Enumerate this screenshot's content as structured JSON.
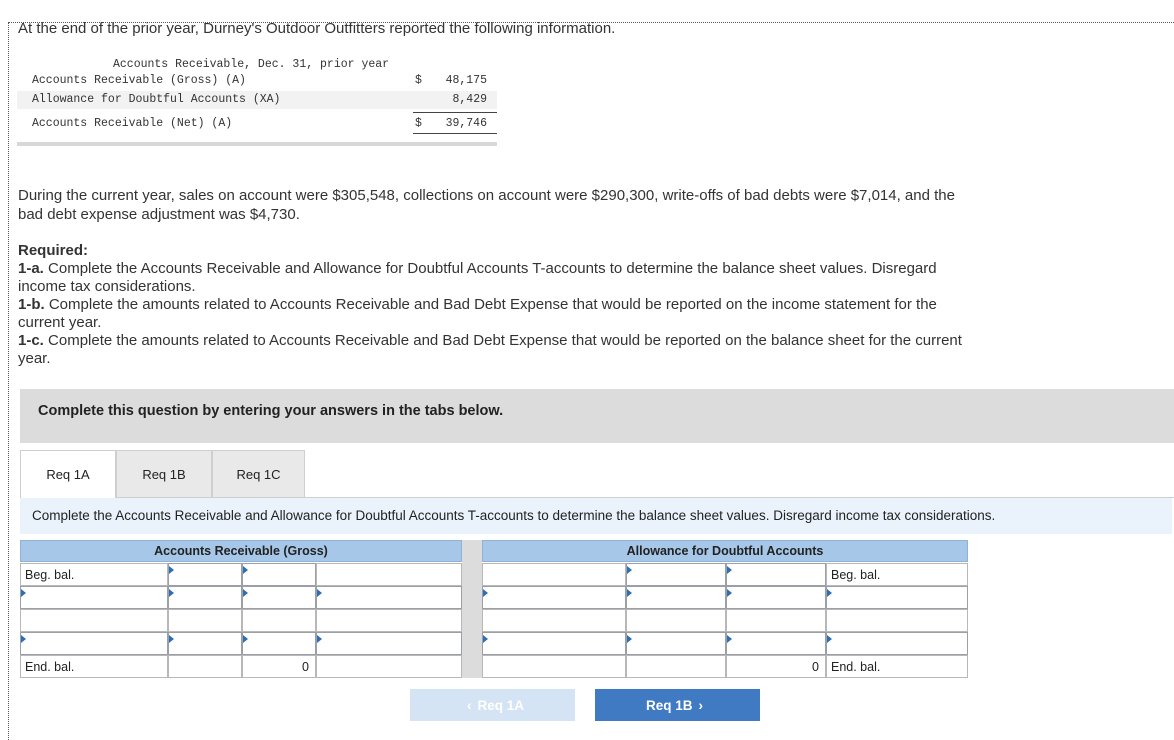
{
  "intro": "At the end of the prior year, Durney's Outdoor Outfitters reported the following information.",
  "mini_table": {
    "header": "Accounts Receivable, Dec. 31, prior year",
    "rows": [
      {
        "label": "Accounts Receivable (Gross) (A)",
        "currency": "$",
        "amount": "48,175"
      },
      {
        "label": "Allowance for Doubtful Accounts (XA)",
        "currency": "",
        "amount": "8,429"
      },
      {
        "label": "Accounts Receivable (Net) (A)",
        "currency": "$",
        "amount": "39,746"
      }
    ]
  },
  "paragraph": "During the current year, sales on account were $305,548, collections on account were $290,300, write-offs of bad debts were $7,014, and the bad debt expense adjustment was $4,730.",
  "required": {
    "heading": "Required:",
    "items": [
      {
        "tag": "1-a.",
        "text": "Complete the Accounts Receivable and Allowance for Doubtful Accounts T-accounts to determine the balance sheet values. Disregard income tax considerations."
      },
      {
        "tag": "1-b.",
        "text": "Complete the amounts related to Accounts Receivable and Bad Debt Expense that would be reported on the income statement for the current year."
      },
      {
        "tag": "1-c.",
        "text": "Complete the amounts related to Accounts Receivable and Bad Debt Expense that would be reported on the balance sheet for the current year."
      }
    ]
  },
  "banner": "Complete this question by entering your answers in the tabs below.",
  "tabs": [
    {
      "label": "Req 1A",
      "active": true
    },
    {
      "label": "Req 1B",
      "active": false
    },
    {
      "label": "Req 1C",
      "active": false
    }
  ],
  "instruction": "Complete the Accounts Receivable and Allowance for Doubtful Accounts T-accounts to determine the balance sheet values. Disregard income tax considerations.",
  "t_accounts": {
    "ar": {
      "title": "Accounts Receivable (Gross)",
      "beg_label": "Beg. bal.",
      "end_label": "End. bal.",
      "end_value": "0"
    },
    "allowance": {
      "title": "Allowance for Doubtful Accounts",
      "beg_label": "Beg. bal.",
      "end_label": "End. bal.",
      "end_value": "0"
    }
  },
  "nav": {
    "prev_label": "Req 1A",
    "next_label": "Req 1B",
    "prev_icon": "chevron-left-icon",
    "next_icon": "chevron-right-icon"
  }
}
